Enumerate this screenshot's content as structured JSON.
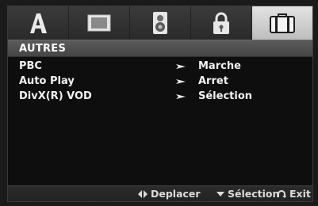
{
  "tabs": [
    {
      "icon": "letter-a-icon"
    },
    {
      "icon": "screen-icon"
    },
    {
      "icon": "speaker-icon"
    },
    {
      "icon": "padlock-icon"
    },
    {
      "icon": "briefcase-icon",
      "active": true
    }
  ],
  "section": {
    "title": "AUTRES"
  },
  "settings": [
    {
      "label": "PBC",
      "value": "Marche"
    },
    {
      "label": "Auto Play",
      "value": "Arret"
    },
    {
      "label": "DivX(R) VOD",
      "value": "Sélection"
    }
  ],
  "footer": {
    "move_label": "Deplacer",
    "select_label": "Sélection",
    "exit_label": "Exit"
  },
  "colors": {
    "tab_active": "#d8d8d8",
    "header": "#4f4f4f",
    "background": "#0e0e0e",
    "text": "#f2f2f2"
  }
}
